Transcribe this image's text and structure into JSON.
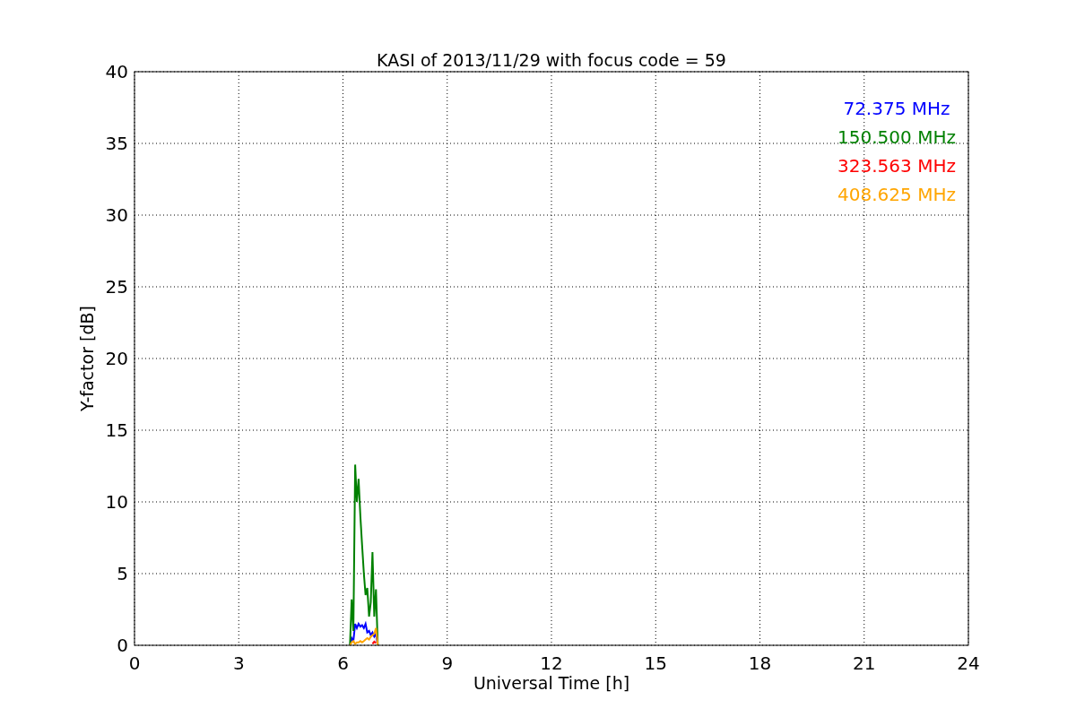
{
  "chart_data": {
    "type": "line",
    "title": "KASI of 2013/11/29 with focus code = 59",
    "xlabel": "Universal Time [h]",
    "ylabel": "Y-factor [dB]",
    "x": [
      6.2,
      6.25,
      6.3,
      6.35,
      6.4,
      6.45,
      6.5,
      6.55,
      6.6,
      6.65,
      6.7,
      6.75,
      6.8,
      6.85,
      6.9,
      6.95,
      7.0
    ],
    "series": [
      {
        "name": "72.375 MHz",
        "color": "#0000ff",
        "values": [
          0,
          0.5,
          0.3,
          1.5,
          1.2,
          1.5,
          1.3,
          1.4,
          1.2,
          1.5,
          0.9,
          1.0,
          0.7,
          0.9,
          0.6,
          0.8,
          0
        ]
      },
      {
        "name": "150.500 MHz",
        "color": "#008000",
        "values": [
          0,
          3.2,
          1.0,
          12.6,
          10.0,
          11.6,
          9.0,
          7.0,
          5.0,
          3.5,
          4.0,
          2.0,
          3.0,
          6.5,
          2.0,
          3.9,
          0
        ]
      },
      {
        "name": "323.563 MHz",
        "color": "#ff0000",
        "values": [
          null,
          null,
          null,
          null,
          null,
          null,
          null,
          null,
          null,
          null,
          null,
          null,
          null,
          0.1,
          0.25,
          0.15,
          null
        ]
      },
      {
        "name": "408.625 MHz",
        "color": "#ffa500",
        "values": [
          0,
          0.2,
          0.3,
          0.1,
          0.2,
          0.2,
          0.3,
          0.2,
          0.3,
          0.4,
          0.5,
          0.4,
          0.6,
          0.7,
          0.8,
          1.2,
          0
        ]
      }
    ],
    "grid": true,
    "xlim": [
      0,
      24
    ],
    "ylim": [
      0,
      40
    ],
    "xticks": [
      0,
      3,
      6,
      9,
      12,
      15,
      18,
      21,
      24
    ],
    "yticks": [
      0,
      5,
      10,
      15,
      20,
      25,
      30,
      35,
      40
    ]
  }
}
